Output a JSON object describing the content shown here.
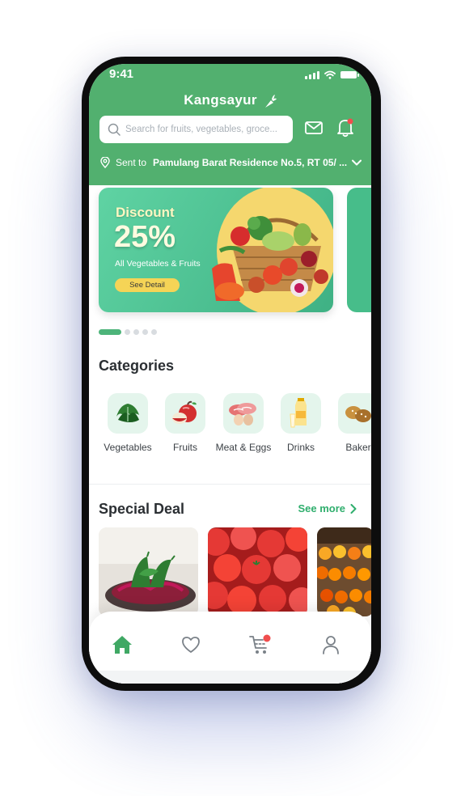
{
  "status_bar": {
    "time": "9:41"
  },
  "header": {
    "brand": "Kangsayur",
    "search_placeholder": "Search for fruits, vegetables, groce...",
    "location_prefix": "Sent to",
    "location_address": "Pamulang Barat Residence No.5, RT 05/ ..."
  },
  "banner": {
    "title": "Discount",
    "percent": "25%",
    "subtitle": "All Vegetables & Fruits",
    "button_label": "See Detail"
  },
  "categories": {
    "title": "Categories",
    "items": [
      {
        "label": "Vegetables",
        "icon": "vegetables-icon"
      },
      {
        "label": "Fruits",
        "icon": "fruits-icon"
      },
      {
        "label": "Meat & Eggs",
        "icon": "meat-eggs-icon"
      },
      {
        "label": "Drinks",
        "icon": "drinks-icon"
      },
      {
        "label": "Baker",
        "icon": "bakery-icon"
      }
    ]
  },
  "special_deal": {
    "title": "Special Deal",
    "see_more_label": "See more"
  },
  "tabbar": {
    "items": [
      "home-icon",
      "heart-icon",
      "cart-icon",
      "profile-icon"
    ]
  },
  "colors": {
    "brand_green": "#52b06f",
    "accent_green": "#2fae6d",
    "badge_red": "#f04e4e",
    "button_yellow": "#f5d456"
  }
}
